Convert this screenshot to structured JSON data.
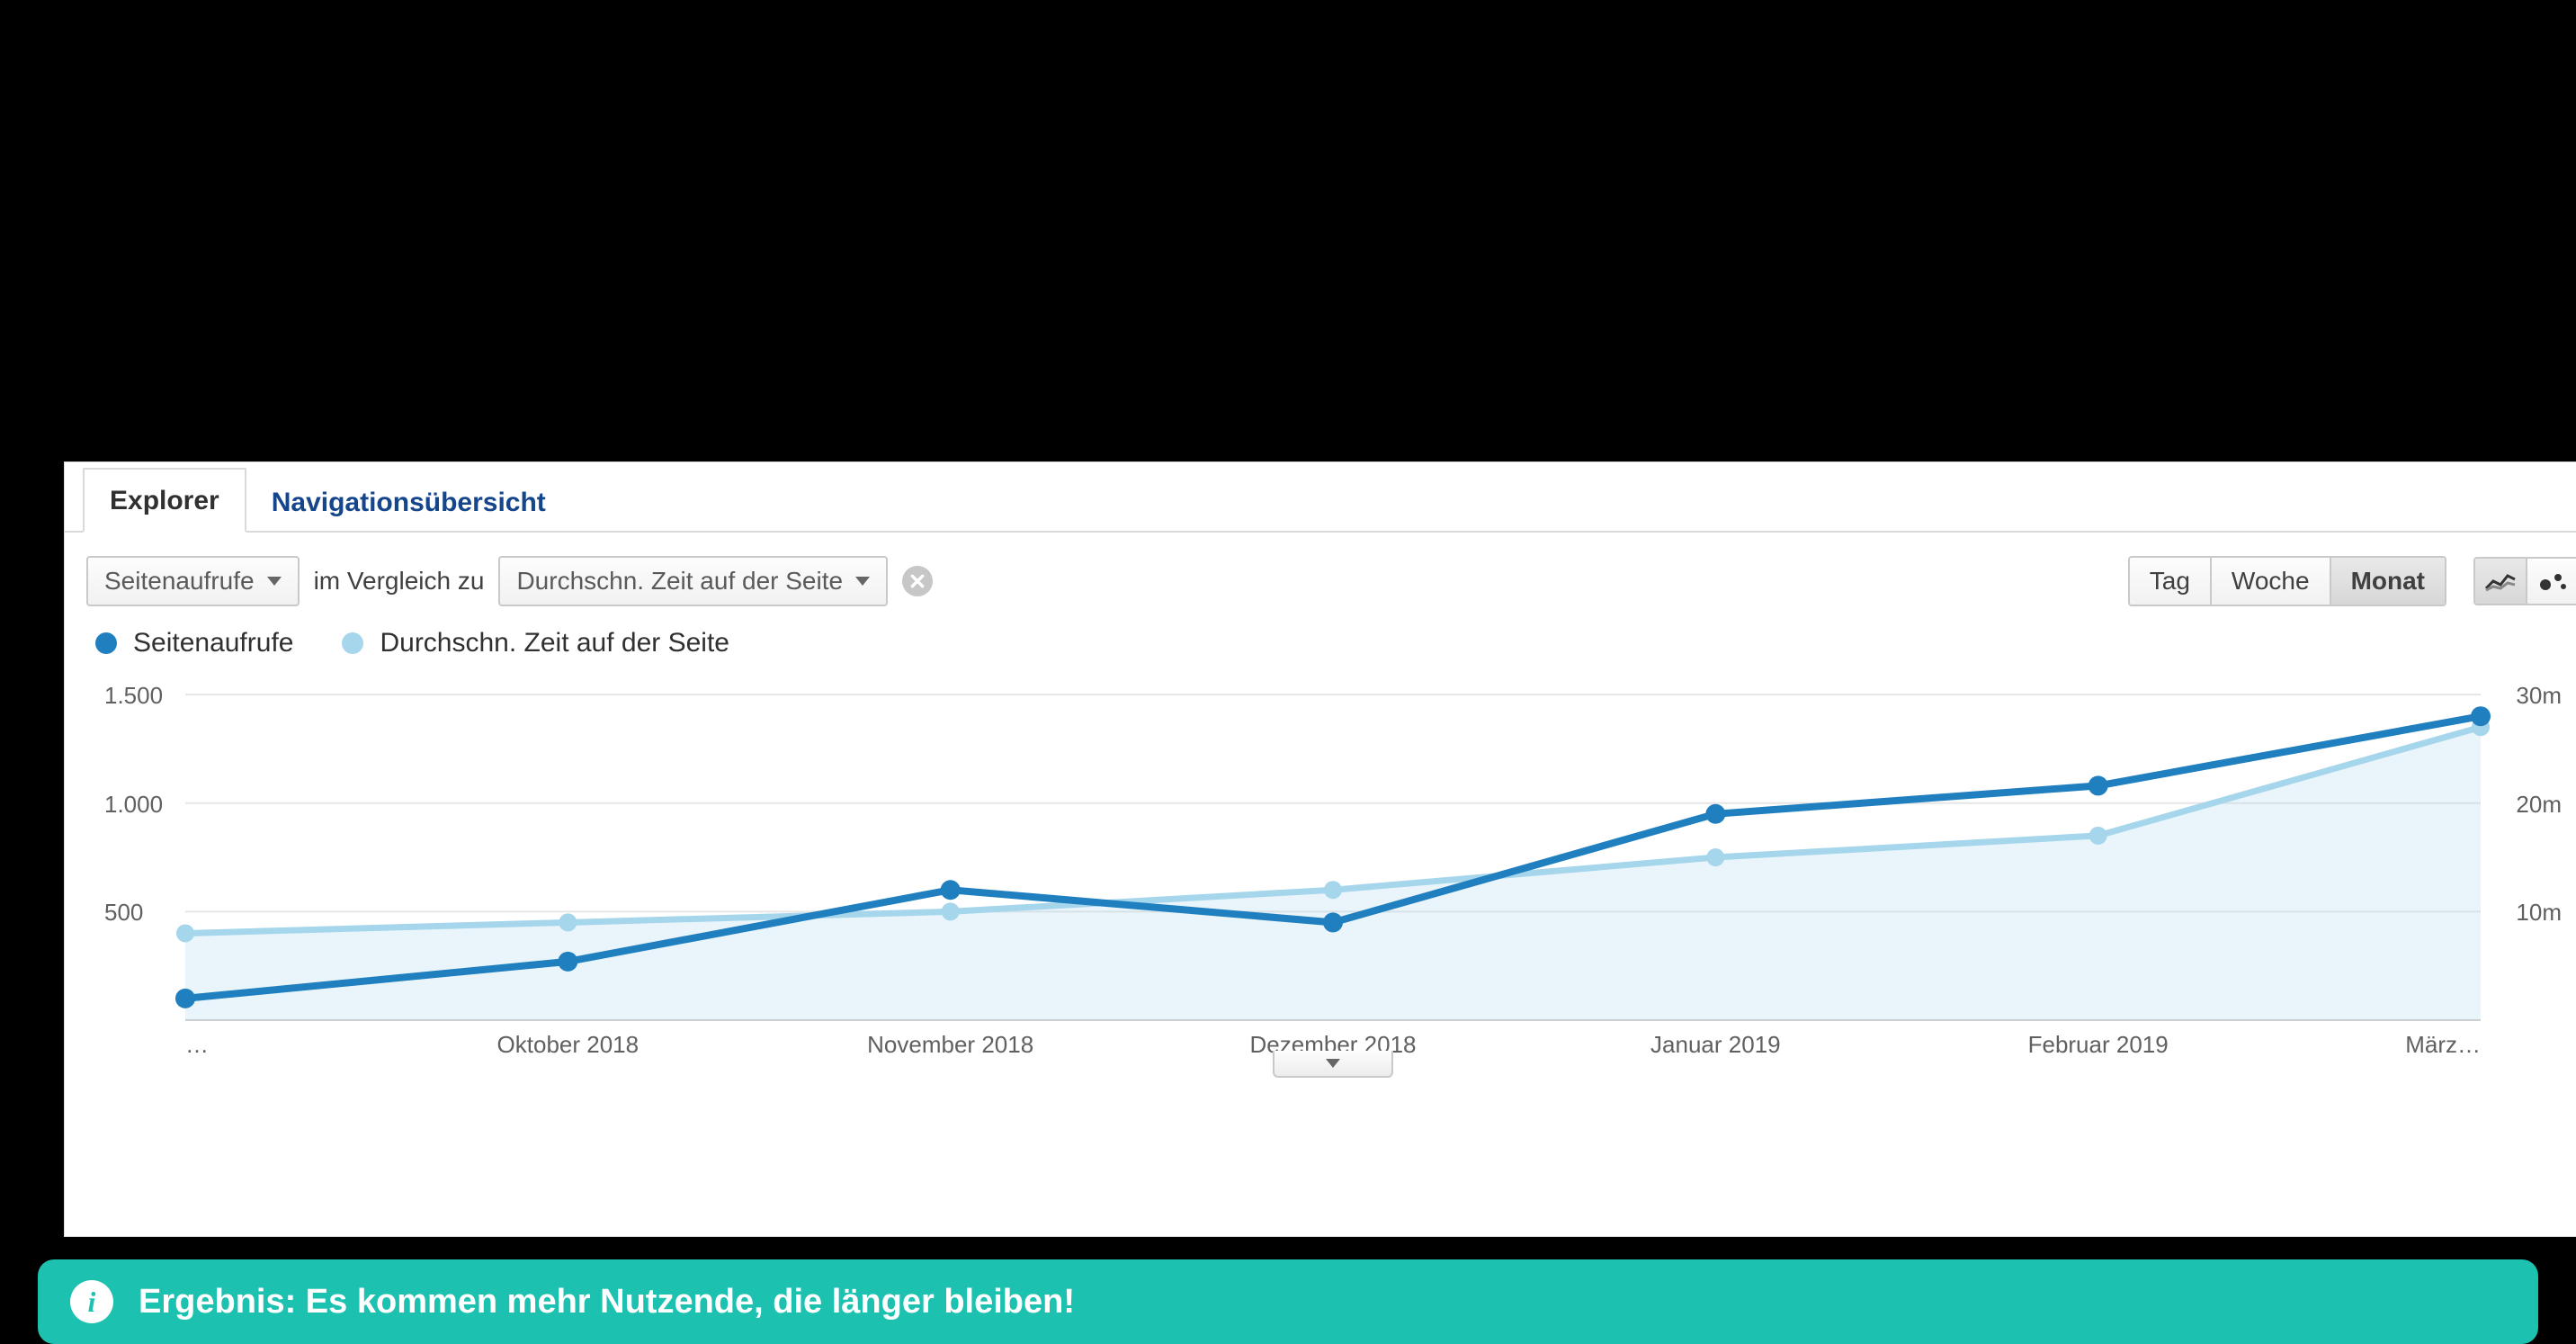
{
  "tabs": {
    "explorer": "Explorer",
    "navigation": "Navigationsübersicht"
  },
  "toolbar": {
    "metric1": "Seitenaufrufe",
    "compare_label": "im Vergleich zu",
    "metric2": "Durchschn. Zeit auf der Seite",
    "granularity": {
      "day": "Tag",
      "week": "Woche",
      "month": "Monat"
    }
  },
  "legend": {
    "series1": {
      "label": "Seitenaufrufe",
      "color": "#1f7fbf"
    },
    "series2": {
      "label": "Durchschn. Zeit auf der Seite",
      "color": "#a6d6ec"
    }
  },
  "banner": {
    "text": "Ergebnis: Es kommen mehr Nutzende, die länger bleiben!"
  },
  "chart_data": {
    "type": "line",
    "categories": [
      "…",
      "Oktober 2018",
      "November 2018",
      "Dezember 2018",
      "Januar 2019",
      "Februar 2019",
      "März…"
    ],
    "series": [
      {
        "name": "Seitenaufrufe",
        "axis": "left",
        "color": "#1f7fbf",
        "values": [
          100,
          270,
          600,
          450,
          950,
          1080,
          1400
        ]
      },
      {
        "name": "Durchschn. Zeit auf der Seite",
        "axis": "right",
        "color": "#a6d6ec",
        "values": [
          8,
          9,
          10,
          12,
          15,
          17,
          27
        ]
      }
    ],
    "y_left": {
      "label": "",
      "ticks": [
        500,
        1000,
        1500
      ],
      "tick_labels": [
        "500",
        "1.000",
        "1.500"
      ],
      "range": [
        0,
        1550
      ]
    },
    "y_right": {
      "label": "",
      "ticks": [
        10,
        20,
        30
      ],
      "tick_labels": [
        "10m",
        "20m",
        "30m"
      ],
      "range": [
        0,
        31
      ]
    },
    "grid": true,
    "legend_position": "top-left"
  }
}
